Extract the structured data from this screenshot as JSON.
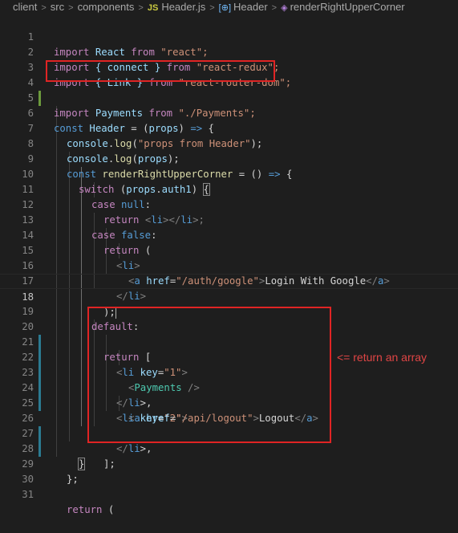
{
  "breadcrumb": {
    "items": [
      "client",
      "src",
      "components",
      "Header.js",
      "Header",
      "renderRightUpperCorner"
    ],
    "file_icon": "JS"
  },
  "editor": {
    "line_numbers": [
      "1",
      "2",
      "3",
      "4",
      "5",
      "6",
      "7",
      "8",
      "9",
      "10",
      "11",
      "12",
      "13",
      "14",
      "15",
      "16",
      "17",
      "18",
      "19",
      "20",
      "21",
      "22",
      "23",
      "24",
      "25",
      "26",
      "27",
      "28",
      "29",
      "30",
      "31"
    ],
    "current_line": "18"
  },
  "code": {
    "l1": [
      "import",
      " React ",
      "from",
      " \"react\";"
    ],
    "l2": [
      "import",
      " { connect } ",
      "from",
      " \"react-redux\";"
    ],
    "l3": [
      "import",
      " { Link } ",
      "from",
      " \"react-router-dom\";"
    ],
    "l4": [
      "import",
      " Payments ",
      "from",
      " \"./Payments\";"
    ],
    "l6": [
      "const",
      " Header ",
      "= (",
      "props",
      ") ",
      "=>",
      " {"
    ],
    "l7": [
      "console",
      ".",
      "log",
      "(",
      "\"props from Header\"",
      ");"
    ],
    "l8": [
      "console",
      ".",
      "log",
      "(",
      "props",
      ");"
    ],
    "l9": [
      "const",
      " renderRightUpperCorner ",
      "= () ",
      "=>",
      " {"
    ],
    "l10": [
      "switch",
      " (",
      "props",
      ".",
      "auth1",
      ") ",
      "{"
    ],
    "l11": [
      "case",
      " ",
      "null",
      ":"
    ],
    "l12": [
      "return",
      " <",
      "li",
      "></",
      "li",
      ">;"
    ],
    "l13": [
      "case",
      " ",
      "false",
      ":"
    ],
    "l14": [
      "return",
      " ("
    ],
    "l15": [
      "<",
      "li",
      ">"
    ],
    "l16": [
      "<",
      "a",
      " ",
      "href",
      "=",
      "\"/auth/google\"",
      ">",
      "Login With Google",
      "</",
      "a",
      ">"
    ],
    "l17": [
      "</",
      "li",
      ">"
    ],
    "l18": [
      ")",
      ";"
    ],
    "l19": [
      "default",
      ":"
    ],
    "l20": [
      "return",
      " ["
    ],
    "l21": [
      "<",
      "li",
      " ",
      "key",
      "=",
      "\"1\"",
      ">"
    ],
    "l22": [
      "<",
      "Payments",
      " />"
    ],
    "l23": [
      "</",
      "li",
      ">,"
    ],
    "l24": [
      "<",
      "li",
      " ",
      "key",
      "=",
      "\"2\"",
      ">"
    ],
    "l25": [
      "<",
      "a",
      " ",
      "href",
      "=",
      "\"/api/logout\"",
      ">",
      "Logout",
      "</",
      "a",
      ">"
    ],
    "l26": [
      "</",
      "li",
      ">,"
    ],
    "l27": [
      "];"
    ],
    "l28": [
      "}"
    ],
    "l29": [
      "};"
    ],
    "l31": [
      "return",
      " ("
    ]
  },
  "annotation": {
    "text": "<= return an array",
    "color": "#e02424"
  }
}
